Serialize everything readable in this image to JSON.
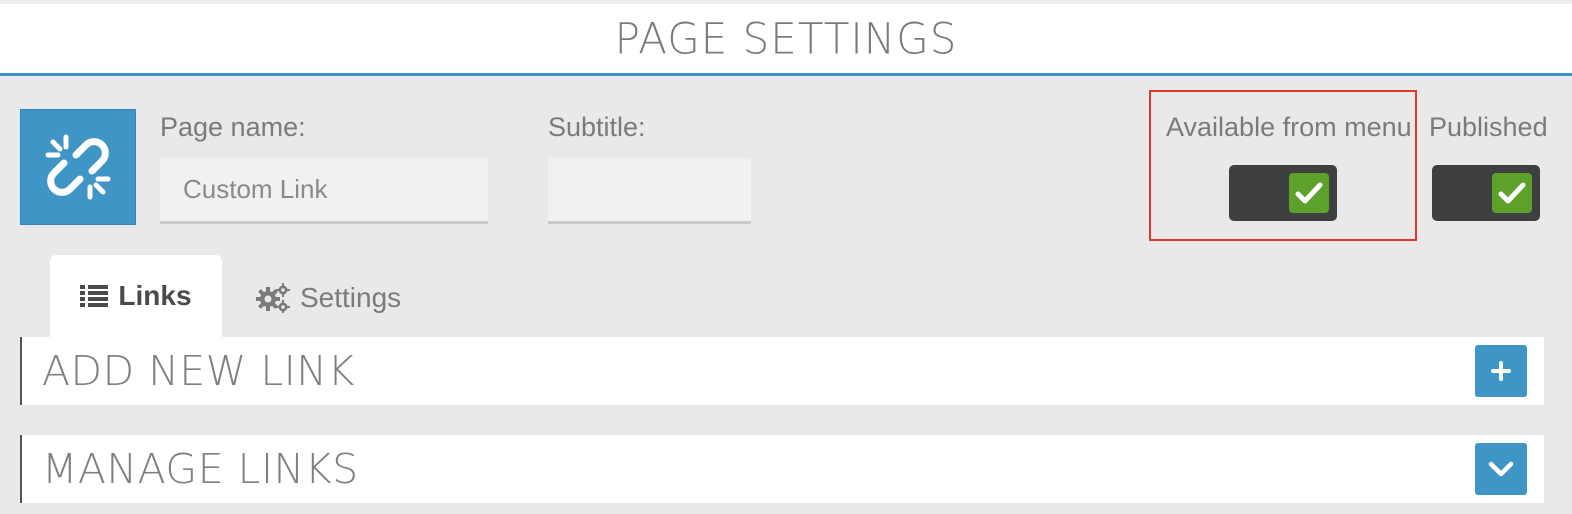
{
  "header": {
    "title": "PAGE SETTINGS"
  },
  "app_icon": {
    "icon": "broken-link-icon",
    "color": "#3f95c6"
  },
  "form": {
    "page_name_label": "Page name:",
    "page_name_value": "Custom Link",
    "subtitle_label": "Subtitle:",
    "subtitle_value": ""
  },
  "toggles": {
    "available_label": "Available from menu",
    "available_checked": true,
    "published_label": "Published",
    "published_checked": true
  },
  "tabs": [
    {
      "label": "Links",
      "icon": "list-icon",
      "active": true
    },
    {
      "label": "Settings",
      "icon": "gears-icon",
      "active": false
    }
  ],
  "panels": [
    {
      "title": "ADD NEW LINK",
      "button_icon": "plus-icon"
    },
    {
      "title": "MANAGE LINKS",
      "button_icon": "chevron-down-icon"
    }
  ],
  "colors": {
    "accent": "#3f95c6",
    "toggle_on": "#5da12a",
    "toggle_track": "#3e3f40",
    "highlight": "#e0392b"
  }
}
